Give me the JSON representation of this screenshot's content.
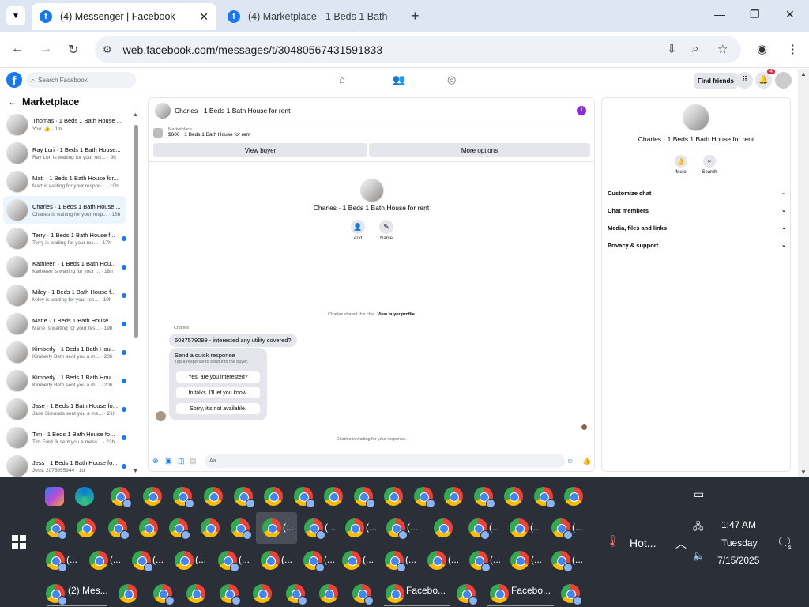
{
  "browser": {
    "tabs": [
      {
        "title": "(4) Messenger | Facebook",
        "active": true
      },
      {
        "title": "(4) Marketplace - 1 Beds 1 Bath",
        "active": false
      }
    ],
    "url": "web.facebook.com/messages/t/30480567431591833"
  },
  "fb": {
    "search_placeholder": "Search Facebook",
    "find_friends": "Find friends",
    "notification_count": "4"
  },
  "left": {
    "title": "Marketplace",
    "conversations": [
      {
        "name": "Thomas · 1 Beds 1 Bath House ...",
        "sub": "You: 👍 · 1m",
        "unread": false
      },
      {
        "name": "Ray Lori · 1 Beds 1 Bath House...",
        "sub": "Ray Lori is waiting for your res... · 9h",
        "unread": false
      },
      {
        "name": "Matt · 1 Beds 1 Bath House for...",
        "sub": "Matt is waiting for your respon... · 10h",
        "unread": false
      },
      {
        "name": "Charles · 1 Beds 1 Bath House ...",
        "sub": "Charles is waiting for your resp... · 16h",
        "unread": false
      },
      {
        "name": "Terry · 1 Beds 1 Bath House f...",
        "sub": "Terry is waiting for your res... · 17h",
        "unread": true
      },
      {
        "name": "Kathleen · 1 Beds 1 Bath Hou...",
        "sub": "Kathleen is waiting for your ... · 18h",
        "unread": true
      },
      {
        "name": "Miley · 1 Beds 1 Bath House f...",
        "sub": "Miley is waiting for your res... · 19h",
        "unread": true
      },
      {
        "name": "Marie · 1 Beds 1 Bath House ...",
        "sub": "Marie is waiting for your res... · 19h",
        "unread": true
      },
      {
        "name": "Kimberly · 1 Beds 1 Bath Hou...",
        "sub": "Kimberly Beth sent you a m... · 20h",
        "unread": true
      },
      {
        "name": "Kimberly · 1 Beds 1 Bath Hou...",
        "sub": "Kimberly Beth sent you a m... · 20h",
        "unread": true
      },
      {
        "name": "Jase · 1 Beds 1 Bath House fo...",
        "sub": "Jase Simonds sent you a me... · 21h",
        "unread": true
      },
      {
        "name": "Tim · 1 Beds 1 Bath House fo...",
        "sub": "Tim Ford Jr sent you a mess... · 22h",
        "unread": true
      },
      {
        "name": "Jess · 1 Beds 1 Bath House fo...",
        "sub": "Jess: 2075955944 · 1d",
        "unread": true
      }
    ]
  },
  "chat": {
    "title": "Charles · 1 Beds 1 Bath House for rent",
    "marketplace_label": "Marketplace",
    "listing": "$600 · 1 Beds 1 Bath House for rent",
    "view_buyer": "View buyer",
    "more_options": "More options",
    "center_name": "Charles · 1 Beds 1 Bath House for rent",
    "add_label": "Add",
    "name_label": "Name",
    "started_text": "Charles started this chat.",
    "view_profile": "View buyer profile",
    "sender": "Charles",
    "message": "6037579099 - interested any utility covered?",
    "quick_title": "Send a quick response",
    "quick_sub": "Tap a response to send it to the buyer.",
    "quick_options": [
      "Yes, are you interested?",
      "In talks. I'll let you know.",
      "Sorry, it's not available."
    ],
    "waiting": "Charles is waiting for your response.",
    "composer_placeholder": "Aa"
  },
  "right": {
    "name": "Charles · 1 Beds 1 Bath House for rent",
    "mute": "Mute",
    "search": "Search",
    "sections": [
      "Customize chat",
      "Chat members",
      "Media, files and links",
      "Privacy & support"
    ]
  },
  "taskbar": {
    "messenger_label": "(2) Mes...",
    "facebook_label_1": "Facebo...",
    "facebook_label_2": "Facebo...",
    "ellipsis": "(...",
    "weather": "Hot...",
    "time": "1:47 AM",
    "day": "Tuesday",
    "date": "7/15/2025",
    "notif_count": "4"
  }
}
